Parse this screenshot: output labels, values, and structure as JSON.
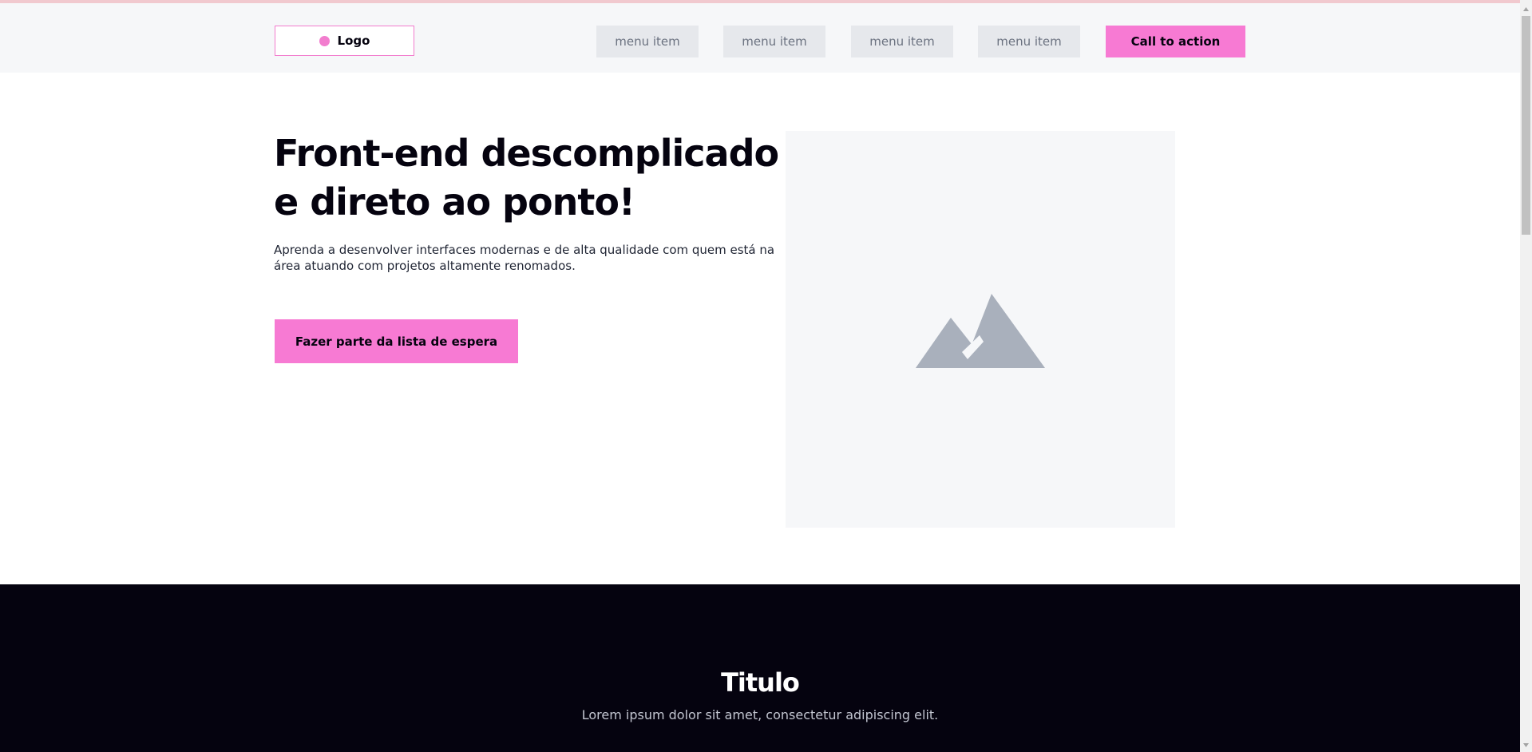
{
  "header": {
    "logo_label": "Logo",
    "nav_items": [
      "menu item",
      "menu item",
      "menu item",
      "menu item"
    ],
    "cta_label": "Call to action"
  },
  "hero": {
    "title": "Front-end descomplicado e direto ao ponto!",
    "description": "Aprenda a desenvolver interfaces modernas e de alta qualidade com quem está na área atuando com projetos altamente renomados.",
    "button_label": "Fazer parte da lista de espera",
    "image_icon": "mountain-icon"
  },
  "section": {
    "title": "Titulo",
    "subtitle": "Lorem ipsum dolor sit amet, consectetur adipiscing elit."
  },
  "colors": {
    "accent": "#f77ad3",
    "dark": "#05030f",
    "header_bg": "#f6f7f9",
    "menu_bg": "#e6e8ec"
  }
}
